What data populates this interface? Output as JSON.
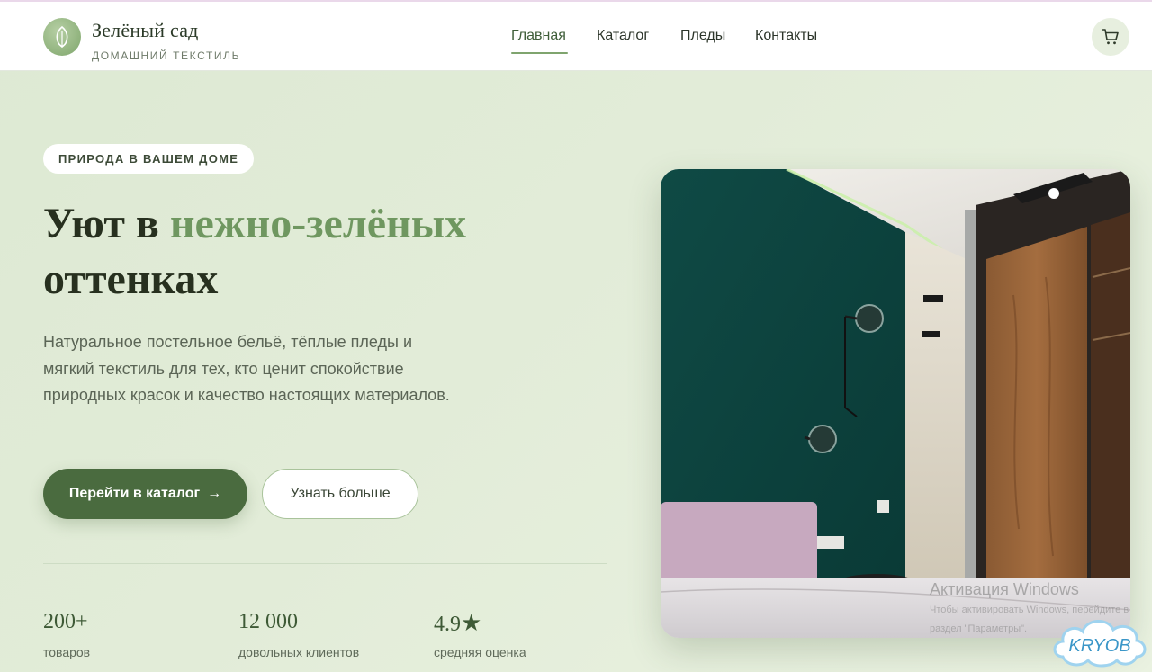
{
  "header": {
    "brand_name": "Зелёный сад",
    "brand_sub": "ДОМАШНИЙ ТЕКСТИЛЬ",
    "logo_icon": "leaf-icon",
    "nav": [
      {
        "label": "Главная",
        "active": true
      },
      {
        "label": "Каталог",
        "active": false
      },
      {
        "label": "Пледы",
        "active": false
      },
      {
        "label": "Контакты",
        "active": false
      }
    ],
    "cart_icon": "cart-icon"
  },
  "hero": {
    "badge": "ПРИРОДА В ВАШЕМ ДОМЕ",
    "title_part1": "Уют в ",
    "title_accent": "нежно-зелёных",
    "title_part2": "оттенках",
    "description": "Натуральное постельное бельё, тёплые пледы и мягкий текстиль для тех, кто ценит спокойствие природных красок и качество настоящих материалов.",
    "primary_button": "Перейти в каталог",
    "primary_button_icon": "arrow-right-icon",
    "secondary_button": "Узнать больше",
    "image_alt": "Интерьер спальни с зелёной стеной и деревянным шкафом"
  },
  "stats": [
    {
      "value": "200+",
      "label": "товаров"
    },
    {
      "value": "12 000",
      "label": "довольных клиентов"
    },
    {
      "value": "4.9",
      "suffix": "★",
      "label": "средняя оценка"
    }
  ],
  "overlay": {
    "windows_title": "Активация Windows",
    "windows_line1": "Чтобы активировать Windows, перейдите в",
    "windows_line2": "раздел \"Параметры\".",
    "watermark_text": "KRYOB"
  },
  "colors": {
    "accent": "#6f9760",
    "primary_button": "#4a6b3f",
    "background": "#e2ecd8"
  }
}
